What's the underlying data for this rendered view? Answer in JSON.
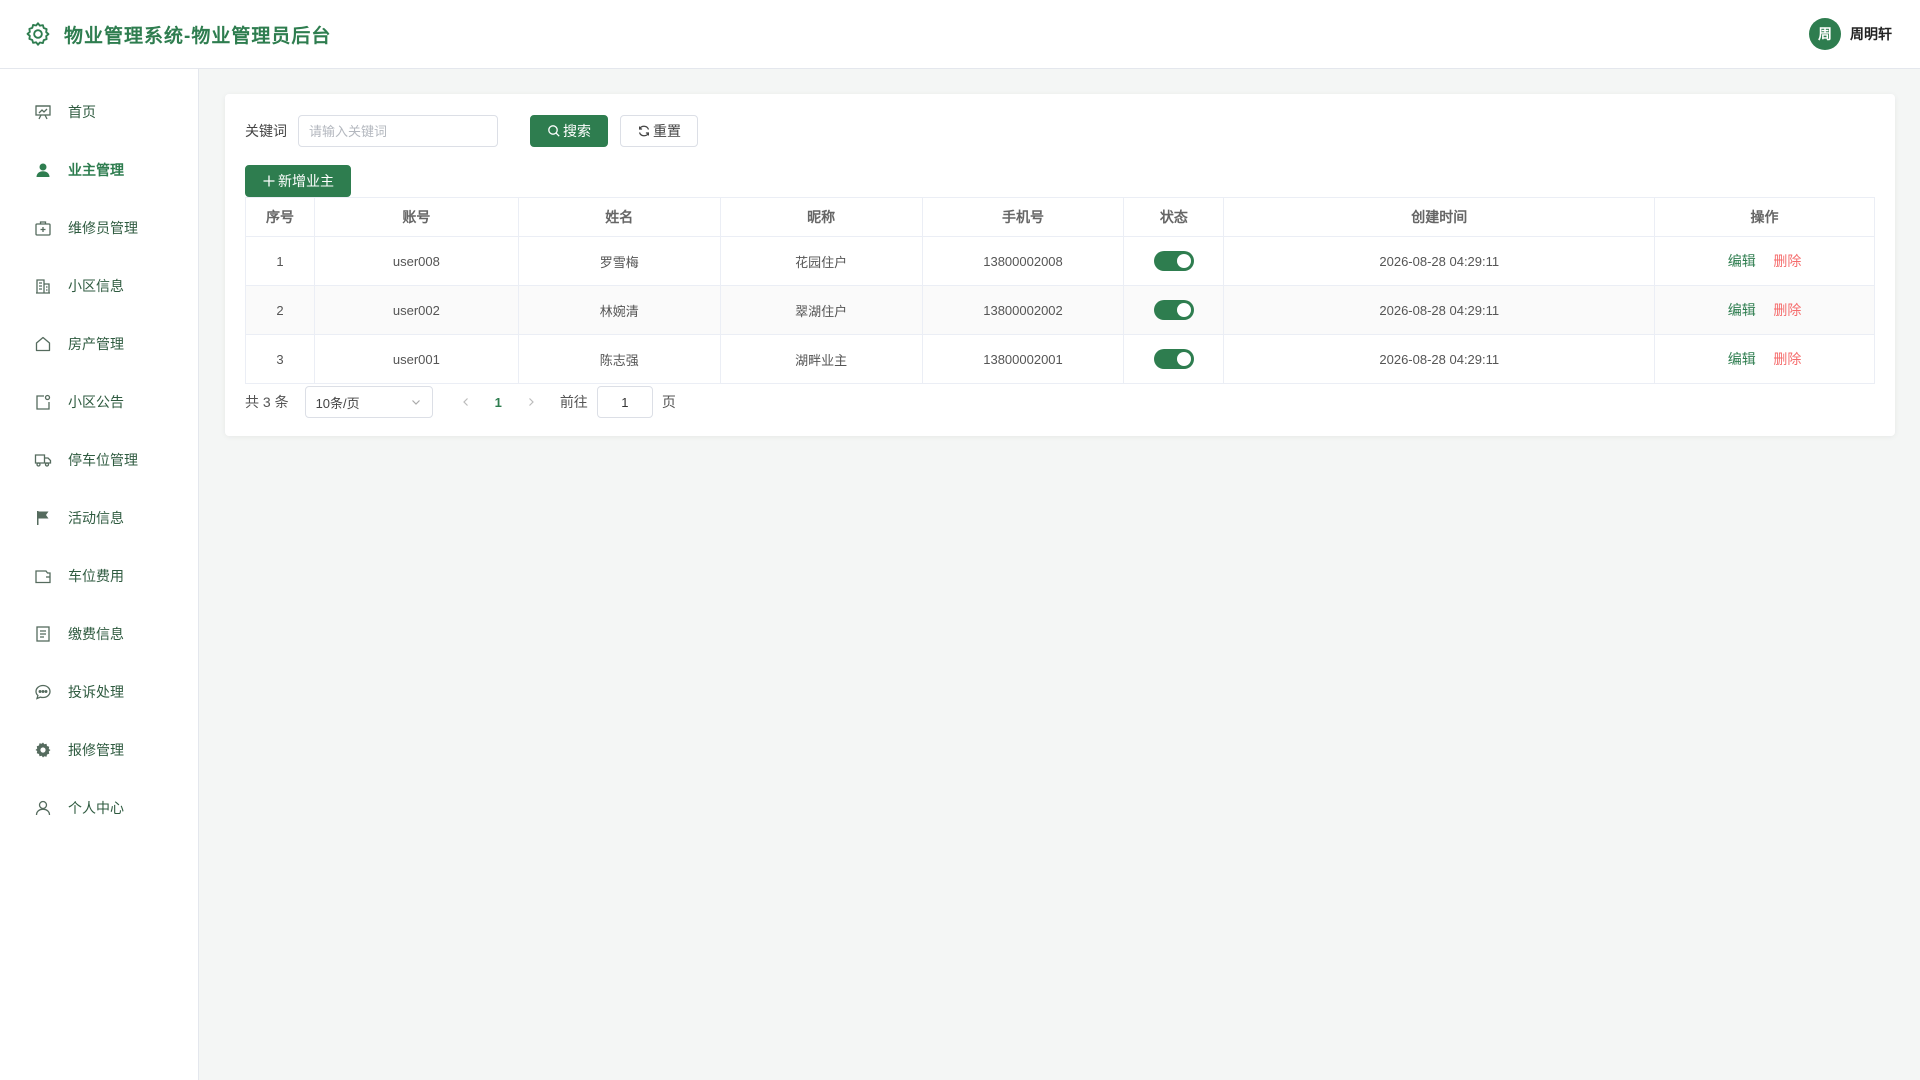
{
  "header": {
    "title": "物业管理系统-物业管理员后台",
    "user_avatar_text": "周",
    "user_name": "周明轩"
  },
  "colors": {
    "accent": "#2e7d4f",
    "danger": "#f56c6c"
  },
  "sidebar": {
    "items": [
      {
        "label": "首页",
        "icon": "dashboard-icon"
      },
      {
        "label": "业主管理",
        "icon": "user-filled-icon",
        "active": true
      },
      {
        "label": "维修员管理",
        "icon": "first-aid-kit-icon"
      },
      {
        "label": "小区信息",
        "icon": "office-building-icon"
      },
      {
        "label": "房产管理",
        "icon": "house-icon"
      },
      {
        "label": "小区公告",
        "icon": "notice-icon"
      },
      {
        "label": "停车位管理",
        "icon": "van-icon"
      },
      {
        "label": "活动信息",
        "icon": "flag-icon"
      },
      {
        "label": "车位费用",
        "icon": "wallet-icon"
      },
      {
        "label": "缴费信息",
        "icon": "document-icon"
      },
      {
        "label": "投诉处理",
        "icon": "chat-dot-icon"
      },
      {
        "label": "报修管理",
        "icon": "gear-icon"
      },
      {
        "label": "个人中心",
        "icon": "user-icon"
      }
    ]
  },
  "search": {
    "label": "关键词",
    "placeholder": "请输入关键词",
    "value": "",
    "search_label": "搜索",
    "reset_label": "重置"
  },
  "toolbar": {
    "add_label": "新增业主"
  },
  "table": {
    "columns": [
      "序号",
      "账号",
      "姓名",
      "昵称",
      "手机号",
      "状态",
      "创建时间",
      "操作"
    ],
    "rows": [
      {
        "index": "1",
        "account": "user008",
        "name": "罗雪梅",
        "nickname": "花园住户",
        "phone": "13800002008",
        "enabled": true,
        "created": "2026-08-28 04:29:11"
      },
      {
        "index": "2",
        "account": "user002",
        "name": "林婉清",
        "nickname": "翠湖住户",
        "phone": "13800002002",
        "enabled": true,
        "created": "2026-08-28 04:29:11"
      },
      {
        "index": "3",
        "account": "user001",
        "name": "陈志强",
        "nickname": "湖畔业主",
        "phone": "13800002001",
        "enabled": true,
        "created": "2026-08-28 04:29:11"
      }
    ],
    "edit_label": "编辑",
    "delete_label": "删除"
  },
  "pagination": {
    "total_text": "共 3 条",
    "page_size": "10条/页",
    "current_page": "1",
    "goto_label": "前往",
    "goto_value": "1",
    "page_suffix": "页"
  }
}
